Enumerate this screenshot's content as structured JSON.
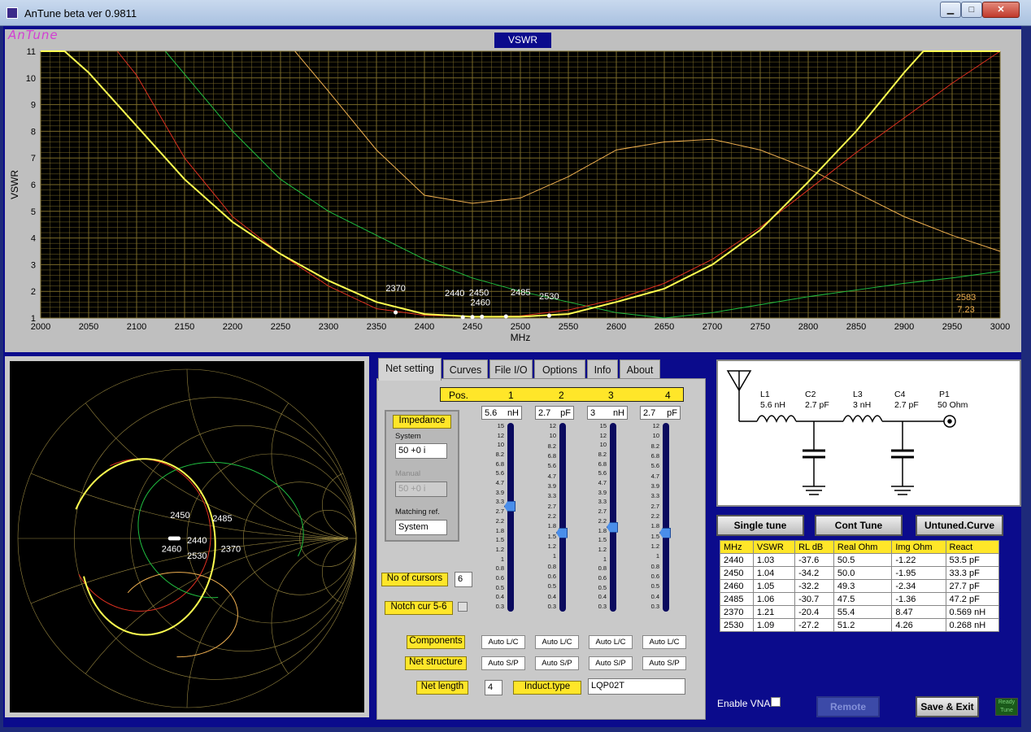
{
  "window": {
    "title": "AnTune beta ver 0.9811",
    "minimize": "▁",
    "maximize": "□",
    "close": "✕"
  },
  "logo": "AnTune",
  "vswr_tab": "VSWR",
  "colors": {
    "curve_main": "#ffff50",
    "curve_red": "#e03020",
    "curve_green": "#20c040",
    "curve_orange": "#f0b050",
    "grid": "#7a6a28",
    "plot_bg": "#000000"
  },
  "chart_data": {
    "type": "line",
    "xlabel": "MHz",
    "ylabel": "VSWR",
    "xlim": [
      2000,
      3000
    ],
    "ylim": [
      1,
      11
    ],
    "x_ticks": [
      2000,
      2050,
      2100,
      2150,
      2200,
      2250,
      2300,
      2350,
      2400,
      2450,
      2500,
      2550,
      2600,
      2650,
      2700,
      2750,
      2800,
      2850,
      2900,
      2950,
      3000
    ],
    "y_ticks": [
      1,
      2,
      3,
      4,
      5,
      6,
      7,
      8,
      9,
      10,
      11
    ],
    "series": [
      {
        "color": "#ffff50",
        "width": 2,
        "points": [
          [
            2000,
            11
          ],
          [
            2025,
            11
          ],
          [
            2050,
            10.2
          ],
          [
            2100,
            8.2
          ],
          [
            2150,
            6.2
          ],
          [
            2200,
            4.6
          ],
          [
            2250,
            3.4
          ],
          [
            2300,
            2.4
          ],
          [
            2350,
            1.6
          ],
          [
            2400,
            1.15
          ],
          [
            2450,
            1.05
          ],
          [
            2500,
            1.05
          ],
          [
            2550,
            1.15
          ],
          [
            2600,
            1.6
          ],
          [
            2650,
            2.1
          ],
          [
            2700,
            3.0
          ],
          [
            2750,
            4.3
          ],
          [
            2800,
            6.1
          ],
          [
            2850,
            8.0
          ],
          [
            2900,
            10.2
          ],
          [
            2920,
            11
          ],
          [
            3000,
            11
          ]
        ]
      },
      {
        "color": "#e03020",
        "width": 1,
        "points": [
          [
            2080,
            11
          ],
          [
            2100,
            10.1
          ],
          [
            2150,
            7.0
          ],
          [
            2200,
            4.8
          ],
          [
            2250,
            3.4
          ],
          [
            2300,
            2.2
          ],
          [
            2350,
            1.35
          ],
          [
            2400,
            1.1
          ],
          [
            2450,
            1.05
          ],
          [
            2500,
            1.08
          ],
          [
            2550,
            1.3
          ],
          [
            2600,
            1.7
          ],
          [
            2650,
            2.3
          ],
          [
            2700,
            3.2
          ],
          [
            2750,
            4.4
          ],
          [
            2800,
            5.8
          ],
          [
            2850,
            7.2
          ],
          [
            2900,
            8.5
          ],
          [
            2950,
            9.8
          ],
          [
            3000,
            11
          ]
        ]
      },
      {
        "color": "#20c040",
        "width": 1,
        "points": [
          [
            2130,
            11
          ],
          [
            2200,
            8.0
          ],
          [
            2250,
            6.2
          ],
          [
            2300,
            5.0
          ],
          [
            2350,
            4.1
          ],
          [
            2400,
            3.2
          ],
          [
            2450,
            2.5
          ],
          [
            2500,
            2.0
          ],
          [
            2550,
            1.6
          ],
          [
            2600,
            1.2
          ],
          [
            2650,
            1.0
          ],
          [
            2700,
            1.2
          ],
          [
            2750,
            1.5
          ],
          [
            2800,
            1.8
          ],
          [
            2850,
            2.05
          ],
          [
            2900,
            2.3
          ],
          [
            2950,
            2.5
          ],
          [
            3000,
            2.75
          ]
        ]
      },
      {
        "color": "#f0b050",
        "width": 1,
        "points": [
          [
            2265,
            11
          ],
          [
            2300,
            9.5
          ],
          [
            2350,
            7.3
          ],
          [
            2400,
            5.6
          ],
          [
            2450,
            5.3
          ],
          [
            2500,
            5.5
          ],
          [
            2550,
            6.3
          ],
          [
            2600,
            7.3
          ],
          [
            2650,
            7.6
          ],
          [
            2700,
            7.7
          ],
          [
            2750,
            7.3
          ],
          [
            2800,
            6.6
          ],
          [
            2850,
            5.7
          ],
          [
            2900,
            4.8
          ],
          [
            2950,
            4.1
          ],
          [
            3000,
            3.5
          ]
        ]
      }
    ],
    "markers": [
      {
        "x": 2370,
        "y": 1.21,
        "label": "2370"
      },
      {
        "x": 2440,
        "y": 1.03,
        "label": "2440"
      },
      {
        "x": 2450,
        "y": 1.04,
        "label": "2450"
      },
      {
        "x": 2460,
        "y": 1.05,
        "label": "2460"
      },
      {
        "x": 2485,
        "y": 1.06,
        "label": "2485"
      },
      {
        "x": 2530,
        "y": 1.09,
        "label": "2530"
      }
    ],
    "readout": {
      "freq": "2583",
      "value": "7.23"
    }
  },
  "smith": {
    "labels": [
      {
        "text": "2450"
      },
      {
        "text": "2485"
      },
      {
        "text": "2440"
      },
      {
        "text": "2460"
      },
      {
        "text": "2530"
      },
      {
        "text": "2370"
      }
    ]
  },
  "tabs": [
    "Net setting",
    "Curves",
    "File I/O",
    "Options",
    "Info",
    "About"
  ],
  "net": {
    "pos_label": "Pos.",
    "positions": [
      "1",
      "2",
      "3",
      "4"
    ],
    "values": [
      {
        "value": "5.6",
        "unit": "nH",
        "level": 0.56
      },
      {
        "value": "2.7",
        "unit": "pF",
        "level": 0.42
      },
      {
        "value": "3",
        "unit": "nH",
        "level": 0.45
      },
      {
        "value": "2.7",
        "unit": "pF",
        "level": 0.42
      }
    ],
    "ticks_l": [
      "15",
      "12",
      "10",
      "8.2",
      "6.8",
      "5.6",
      "4.7",
      "3.9",
      "3.3",
      "2.7",
      "2.2",
      "1.8",
      "1.5",
      "1.2",
      "1",
      "0.8",
      "0.6",
      "0.5",
      "0.4",
      "0.3"
    ],
    "ticks_c": [
      "12",
      "10",
      "8.2",
      "6.8",
      "5.6",
      "4.7",
      "3.9",
      "3.3",
      "2.7",
      "2.2",
      "1.8",
      "1.5",
      "1.2",
      "1",
      "0.8",
      "0.6",
      "0.5",
      "0.4",
      "0.3"
    ],
    "impedance_label": "Impedance",
    "system_label": "System",
    "system_value": "50 +0 i",
    "manual_label": "Manual",
    "manual_value": "50 +0 i",
    "matching_label": "Matching ref.",
    "matching_value": "System",
    "cursors_label": "No of cursors",
    "cursors_value": "6",
    "notch_label": "Notch cur 5-6",
    "components_label": "Components",
    "components": [
      "Auto L/C",
      "Auto L/C",
      "Auto L/C",
      "Auto L/C"
    ],
    "structure_label": "Net structure",
    "structure": [
      "Auto S/P",
      "Auto S/P",
      "Auto S/P",
      "Auto S/P"
    ],
    "length_label": "Net length",
    "length_value": "4",
    "induct_label": "Induct.type",
    "induct_value": "LQP02T"
  },
  "schematic": {
    "parts": [
      {
        "name": "L1",
        "value": "5.6 nH"
      },
      {
        "name": "C2",
        "value": "2.7 pF"
      },
      {
        "name": "L3",
        "value": "3 nH"
      },
      {
        "name": "C4",
        "value": "2.7 pF"
      },
      {
        "name": "P1",
        "value": "50 Ohm"
      }
    ]
  },
  "buttons": {
    "single": "Single tune",
    "cont": "Cont Tune",
    "untuned": "Untuned.Curve",
    "remote": "Remote",
    "save": "Save & Exit"
  },
  "table": {
    "headers": [
      "MHz",
      "VSWR",
      "RL dB",
      "Real Ohm",
      "Img Ohm",
      "React"
    ],
    "rows": [
      [
        "2440",
        "1.03",
        "-37.6",
        "50.5",
        "-1.22",
        "53.5 pF"
      ],
      [
        "2450",
        "1.04",
        "-34.2",
        "50.0",
        "-1.95",
        "33.3 pF"
      ],
      [
        "2460",
        "1.05",
        "-32.2",
        "49.3",
        "-2.34",
        "27.7 pF"
      ],
      [
        "2485",
        "1.06",
        "-30.7",
        "47.5",
        "-1.36",
        "47.2 pF"
      ],
      [
        "2370",
        "1.21",
        "-20.4",
        "55.4",
        "8.47",
        "0.569 nH"
      ],
      [
        "2530",
        "1.09",
        "-27.2",
        "51.2",
        "4.26",
        "0.268 nH"
      ]
    ]
  },
  "vna_label": "Enable VNA",
  "status": "Ready Tune"
}
